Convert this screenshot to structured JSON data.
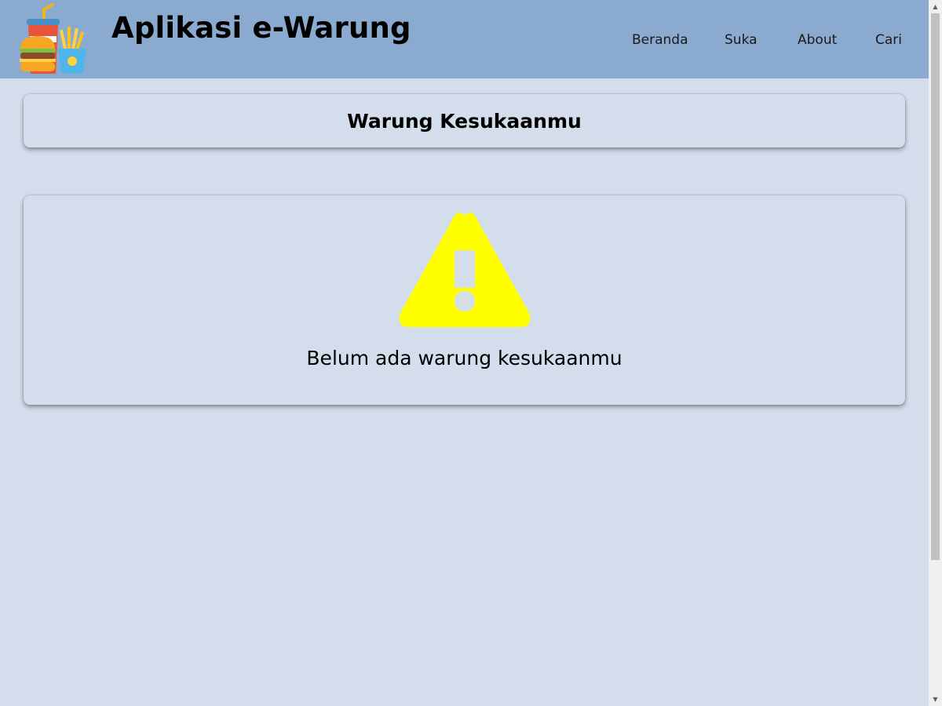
{
  "header": {
    "app_title": "Aplikasi e-Warung",
    "logo_icon": "fast-food-logo-icon",
    "nav": [
      {
        "label": "Beranda"
      },
      {
        "label": "Suka"
      },
      {
        "label": "About"
      },
      {
        "label": "Cari"
      }
    ]
  },
  "main": {
    "section_title": "Warung Kesukaanmu",
    "empty_state": {
      "icon": "warning-icon",
      "message": "Belum ada warung kesukaanmu"
    }
  },
  "colors": {
    "header_bg": "#8baacf",
    "page_bg": "#d4ddec",
    "warning": "#ffff00"
  }
}
